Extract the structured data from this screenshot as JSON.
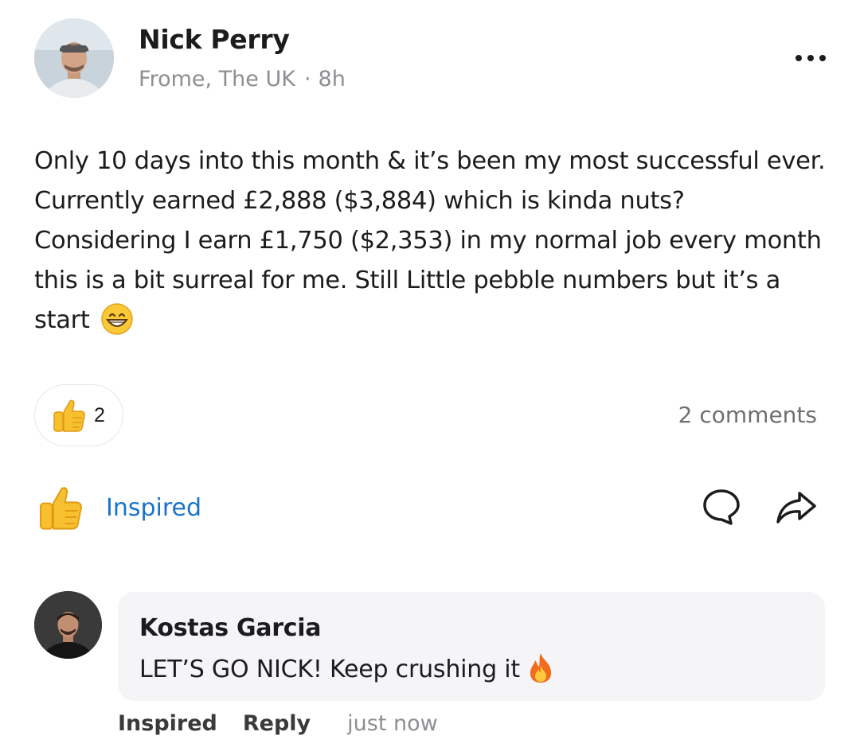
{
  "post": {
    "author": "Nick Perry",
    "location": "Frome, The UK",
    "separator": "·",
    "time": "8h",
    "body": "Only 10 days into this month & it’s been my most successful ever. Currently earned £2,888 ($3,884) which is kinda nuts? Considering I earn £1,750 ($2,353) in my normal job every month this is a bit surreal for me. Still Little pebble numbers but it’s a start",
    "body_emoji_icon": "grinning-face-icon",
    "more_icon": "more-dots-icon"
  },
  "reactions": {
    "icon": "thumbs-up-icon",
    "count": "2",
    "comments_label": "2 comments"
  },
  "actions": {
    "inspired_label": "Inspired",
    "inspired_icon": "thumbs-up-icon",
    "comment_icon": "comment-bubble-icon",
    "share_icon": "share-arrow-icon"
  },
  "comment": {
    "author": "Kostas Garcia",
    "text": "LET’S GO NICK! Keep crushing it",
    "emoji_icon": "fire-icon",
    "actions": {
      "inspired": "Inspired",
      "reply": "Reply",
      "time": "just now"
    }
  },
  "colors": {
    "accent_blue": "#1a73c9",
    "muted_text": "#8e8e93",
    "bubble_bg": "#f5f5f7",
    "thumb_yellow": "#f7c02f"
  }
}
